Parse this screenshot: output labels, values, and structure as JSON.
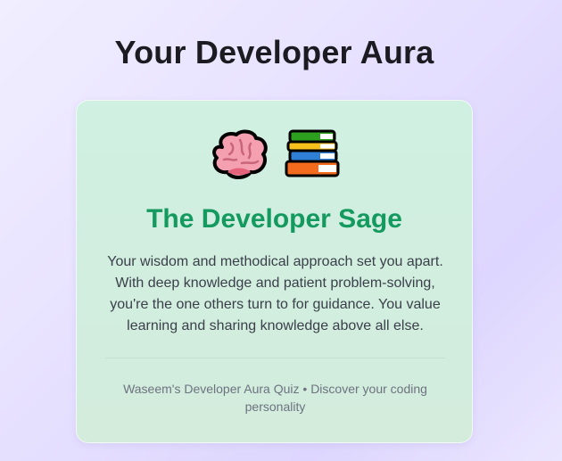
{
  "page": {
    "title": "Your Developer Aura"
  },
  "result": {
    "emojis": [
      "brain-icon",
      "books-icon"
    ],
    "title": "The Developer Sage",
    "description": "Your wisdom and methodical approach set you apart. With deep knowledge and patient problem-solving, you're the one others turn to for guidance. You value learning and sharing knowledge above all else.",
    "footer": "Waseem's Developer Aura Quiz • Discover your coding personality"
  },
  "colors": {
    "title_green": "#149a5f",
    "card_bg": "#d0f0e2",
    "page_bg": "#e6e0ff"
  }
}
